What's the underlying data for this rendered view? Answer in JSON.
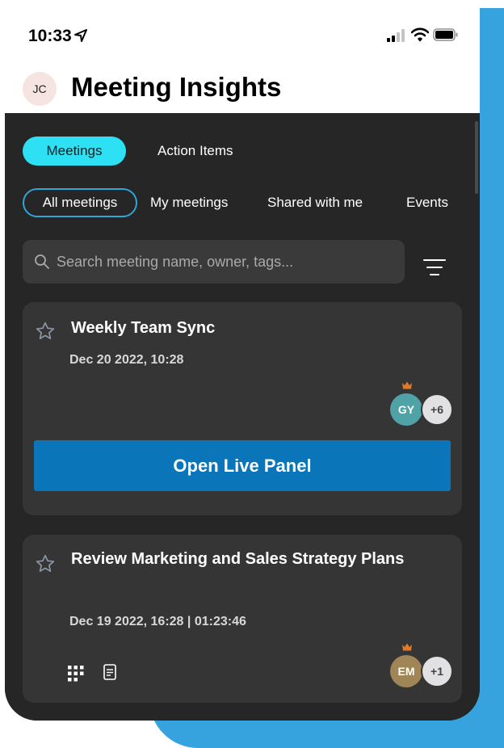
{
  "status_bar": {
    "time": "10:33"
  },
  "header": {
    "avatar_initials": "JC",
    "title": "Meeting Insights"
  },
  "tabs": [
    {
      "label": "Meetings",
      "active": true
    },
    {
      "label": "Action Items",
      "active": false
    }
  ],
  "filters": [
    {
      "label": "All meetings",
      "active": true
    },
    {
      "label": "My meetings",
      "active": false
    },
    {
      "label": "Shared with me",
      "active": false
    },
    {
      "label": "Events",
      "active": false
    }
  ],
  "search": {
    "placeholder": "Search meeting name, owner, tags..."
  },
  "meetings": [
    {
      "title": "Weekly Team Sync",
      "date": "Dec 20 2022, 10:28",
      "owner_initials": "GY",
      "extra_count": "+6",
      "button_label": "Open Live Panel",
      "owner_color": "#4fa2a5"
    },
    {
      "title": "Review Marketing and Sales Strategy Plans",
      "date": "Dec 19 2022, 16:28  |  01:23:46",
      "owner_initials": "EM",
      "extra_count": "+1",
      "owner_color": "#a08556"
    }
  ],
  "colors": {
    "accent": "#2ee0f4",
    "primary_button": "#0a75b9",
    "background_dark": "#262626",
    "card": "#353535",
    "backdrop": "#36a3de",
    "crown": "#e07a2b"
  },
  "icons": [
    "location-arrow-icon",
    "signal-icon",
    "wifi-icon",
    "battery-icon",
    "search-icon",
    "filter-icon",
    "star-icon",
    "crown-icon",
    "grid-icon",
    "document-icon"
  ]
}
